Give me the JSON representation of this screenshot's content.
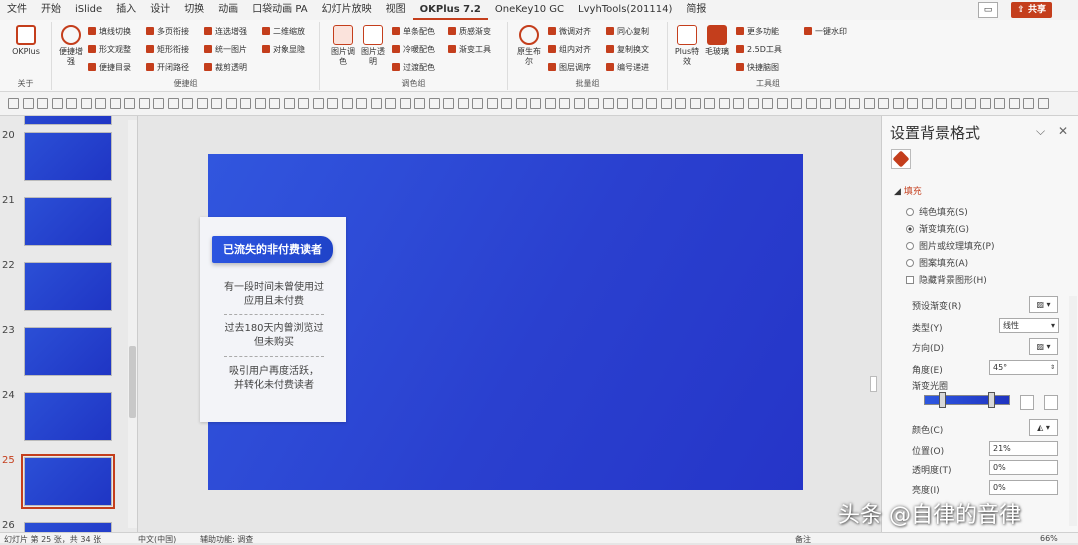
{
  "menu": {
    "tabs": [
      "文件",
      "开始",
      "iSlide",
      "插入",
      "设计",
      "切换",
      "动画",
      "口袋动画 PA",
      "幻灯片放映",
      "视图",
      "OKPlus 7.2",
      "OneKey10 GC",
      "LvyhTools(201114)",
      "简报"
    ],
    "active_tab": "OKPlus 7.2",
    "share_label": "共享"
  },
  "ribbon": {
    "about": {
      "btn": "OKPlus",
      "label": "关于"
    },
    "shortcut": {
      "big": "便捷增强",
      "items": [
        "填线切换",
        "形文观整",
        "便捷目录",
        "多页衔接",
        "矩形衔接",
        "开闭路径",
        "连选增强",
        "统一图片",
        "裁剪透明",
        "二维缩放",
        "对象显隐"
      ],
      "label": "便捷组"
    },
    "color": {
      "bigs": [
        "图片调色",
        "图片透明"
      ],
      "items": [
        "单条配色",
        "冷暖配色",
        "过渡配色",
        "质感渐变",
        "渐变工具"
      ],
      "label": "调色组"
    },
    "batch": {
      "big": "原生布尔",
      "items": [
        "微调对齐",
        "组内对齐",
        "图层调序",
        "同心复制",
        "复制换文",
        "编号递进"
      ],
      "label": "批量组"
    },
    "tools": {
      "bigs": [
        "Plus特效",
        "毛玻璃"
      ],
      "items": [
        "更多功能",
        "2.5D工具",
        "快捷脑图",
        "一键水印"
      ],
      "label": "工具组"
    }
  },
  "thumbnails": {
    "numbers": [
      "20",
      "21",
      "22",
      "23",
      "24",
      "25",
      "26"
    ],
    "selected": "25"
  },
  "slide": {
    "card_title": "已流失的非付费读者",
    "para1": [
      "有一段时间未曾使用过",
      "应用且未付费"
    ],
    "para2": [
      "过去180天内曾浏览过",
      "但未购买"
    ],
    "para3": [
      "吸引用户再度活跃，",
      "并转化未付费读者"
    ]
  },
  "pane": {
    "title": "设置背景格式",
    "section": "填充",
    "options": [
      "纯色填充(S)",
      "渐变填充(G)",
      "图片或纹理填充(P)",
      "图案填充(A)"
    ],
    "selected_option": "渐变填充(G)",
    "hide_bg": "隐藏背景图形(H)",
    "preset_label": "预设渐变(R)",
    "type_label": "类型(Y)",
    "type_value": "线性",
    "direction_label": "方向(D)",
    "angle_label": "角度(E)",
    "angle_value": "45°",
    "stops_label": "渐变光圈",
    "color_label": "颜色(C)",
    "position_label": "位置(O)",
    "position_value": "21%",
    "transparency_label": "透明度(T)",
    "transparency_value": "0%",
    "brightness_label": "亮度(I)",
    "brightness_value": "0%",
    "stops": [
      0.21,
      0.78
    ]
  },
  "status": {
    "slide_info": "幻灯片 第 25 张，共 34 张",
    "language": "中文(中国)",
    "accessibility": "辅助功能: 调查",
    "notes": "备注",
    "zoom": "66%"
  },
  "watermark": "头条 @自律的音律",
  "colors": {
    "accent": "#c43e1c",
    "slide_blue": "#2a40cf"
  }
}
